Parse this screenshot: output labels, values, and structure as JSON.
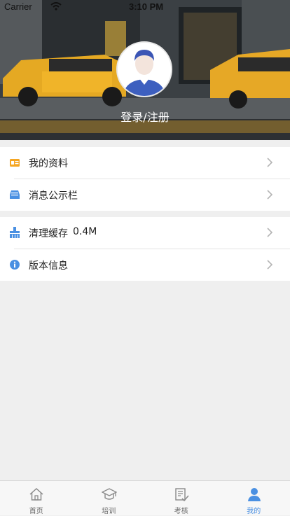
{
  "status_bar": {
    "carrier": "Carrier",
    "time": "3:10 PM"
  },
  "profile": {
    "login_label": "登录/注册"
  },
  "menu_group_1": [
    {
      "label": "我的资料",
      "icon": "id-card-icon"
    },
    {
      "label": "消息公示栏",
      "icon": "inbox-icon"
    }
  ],
  "menu_group_2": [
    {
      "label": "清理缓存",
      "value": "0.4M",
      "icon": "broom-icon"
    },
    {
      "label": "版本信息",
      "icon": "info-icon"
    }
  ],
  "tabs": [
    {
      "label": "首页",
      "icon": "home-icon"
    },
    {
      "label": "培训",
      "icon": "graduation-cap-icon"
    },
    {
      "label": "考核",
      "icon": "document-check-icon"
    },
    {
      "label": "我的",
      "icon": "user-icon",
      "active": true
    }
  ],
  "colors": {
    "accent": "#4a90e2",
    "icon_orange": "#f5a623",
    "background": "#efefef"
  }
}
